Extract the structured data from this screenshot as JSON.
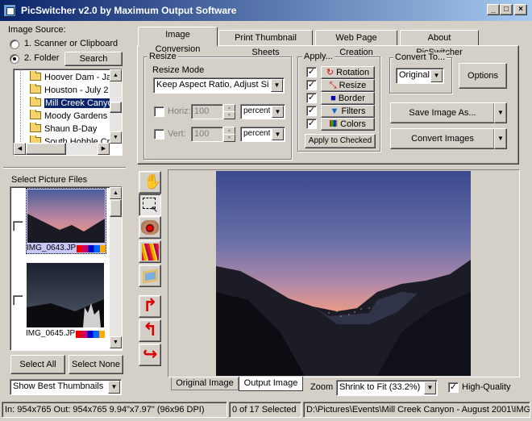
{
  "window": {
    "title": "PicSwitcher v2.0 by Maximum Output Software",
    "controls": [
      "_",
      "□",
      "×"
    ]
  },
  "image_source": {
    "label": "Image Source:",
    "option1": "1. Scanner or Clipboard",
    "option2": "2. Folder",
    "search_button": "Search",
    "folders": [
      "Hoover Dam - Ja",
      "Houston - July 2",
      "Mill Creek Canyon",
      "Moody Gardens",
      "Shaun B-Day",
      "South Hobble Cr"
    ],
    "selected_folder": "Mill Creek Canyon"
  },
  "picture_files": {
    "label": "Select Picture Files",
    "files": [
      "IMG_0643.JP",
      "IMG_0645.JP"
    ],
    "select_all": "Select All",
    "select_none": "Select None",
    "thumbnail_mode": "Show Best Thumbnails"
  },
  "tabs": [
    "Image Conversion",
    "Print Thumbnail Sheets",
    "Web Page Creation",
    "About PicSwitcher"
  ],
  "active_tab": "Image Conversion",
  "resize": {
    "group_label": "Resize",
    "mode_label": "Resize Mode",
    "mode_value": "Keep Aspect Ratio, Adjust Siz",
    "horiz_label": "Horiz:",
    "horiz_value": "100",
    "vert_label": "Vert:",
    "vert_value": "100",
    "unit_value": "percent"
  },
  "apply": {
    "group_label": "Apply...",
    "items": [
      "Rotation",
      "Resize",
      "Border",
      "Filters",
      "Colors"
    ],
    "apply_checked": "Apply to Checked"
  },
  "convert_to": {
    "group_label": "Convert To...",
    "format": "Original",
    "options_button": "Options"
  },
  "save_image_as": "Save Image As...",
  "convert_images": "Convert Images",
  "tools": [
    "hand-icon",
    "select-icon",
    "red-eye-icon",
    "crayons-icon",
    "frame-icon",
    "rotate-right-icon",
    "rotate-left-icon",
    "flip-icon"
  ],
  "preview_tabs": [
    "Original Image",
    "Output Image"
  ],
  "zoom": {
    "label": "Zoom",
    "value": "Shrink to Fit (33.2%)",
    "high_quality_label": "High-Quality"
  },
  "status": {
    "info": "In: 954x765  Out: 954x765  9.94\"x7.97\"  (96x96 DPI)",
    "selected": "0 of 17 Selected",
    "path": "D:\\Pictures\\Events\\Mill Creek Canyon - August 2001\\IMG"
  },
  "colors": {
    "titlebar_start": "#0a246a",
    "titlebar_end": "#a6caf0",
    "selection": "#0a246a",
    "face": "#d4d0c8"
  }
}
